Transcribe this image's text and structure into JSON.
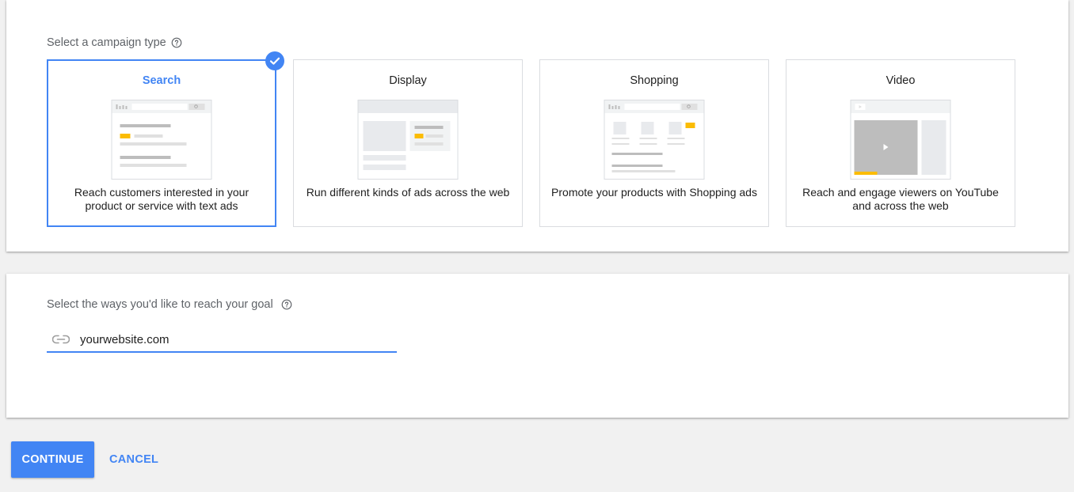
{
  "campaign": {
    "title": "Select a campaign type",
    "cards": [
      {
        "title": "Search",
        "description": "Reach customers interested in your product or service with text ads",
        "selected": true
      },
      {
        "title": "Display",
        "description": "Run different kinds of ads across the web",
        "selected": false
      },
      {
        "title": "Shopping",
        "description": "Promote your products with Shopping ads",
        "selected": false
      },
      {
        "title": "Video",
        "description": "Reach and engage viewers on YouTube and across the web",
        "selected": false
      }
    ]
  },
  "goal": {
    "title": "Select the ways you'd like to reach your goal",
    "website_value": "yourwebsite.com"
  },
  "actions": {
    "continue_label": "CONTINUE",
    "cancel_label": "CANCEL"
  },
  "colors": {
    "accent": "#4285f4",
    "highlight": "#fbbc04"
  }
}
